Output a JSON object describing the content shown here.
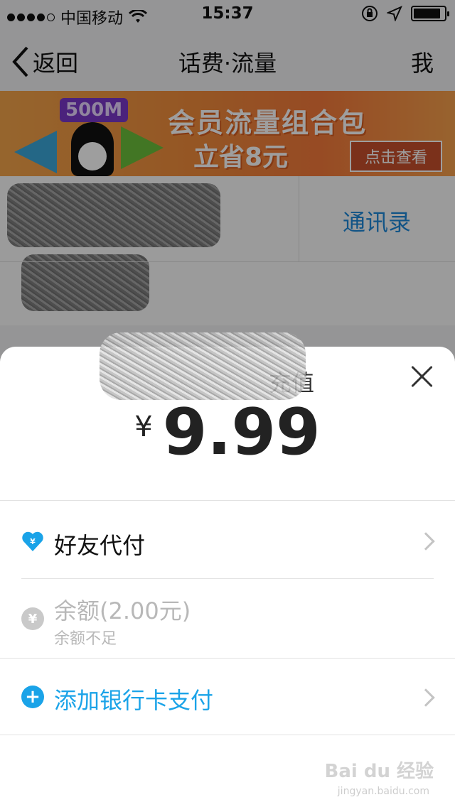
{
  "status_bar": {
    "carrier": "中国移动",
    "time": "15:37"
  },
  "nav": {
    "back_label": "返回",
    "title": "话费·流量",
    "right_label": "我"
  },
  "banner": {
    "badge": "500M",
    "headline": "会员流量组合包",
    "subline": "立省8元",
    "cta": "点击查看"
  },
  "contact": {
    "link_label": "通讯录"
  },
  "sheet": {
    "title_visible_suffix": "充值",
    "currency_symbol": "¥",
    "amount": "9.99",
    "options": [
      {
        "icon": "heart-yen-icon",
        "label": "好友代付",
        "sublabel": "",
        "enabled": true
      },
      {
        "icon": "yen-circle-icon",
        "label": "余额(2.00元)",
        "sublabel": "余额不足",
        "enabled": false
      },
      {
        "icon": "plus-circle-icon",
        "label": "添加银行卡支付",
        "sublabel": "",
        "enabled": true
      }
    ]
  },
  "watermark": {
    "brand": "Bai du 经验",
    "url": "jingyan.baidu.com"
  },
  "colors": {
    "accent_blue": "#1e88d8",
    "add_card_blue": "#1aa3e8",
    "disabled_gray": "#b8b8b8",
    "banner_orange": "#f08a3a"
  }
}
